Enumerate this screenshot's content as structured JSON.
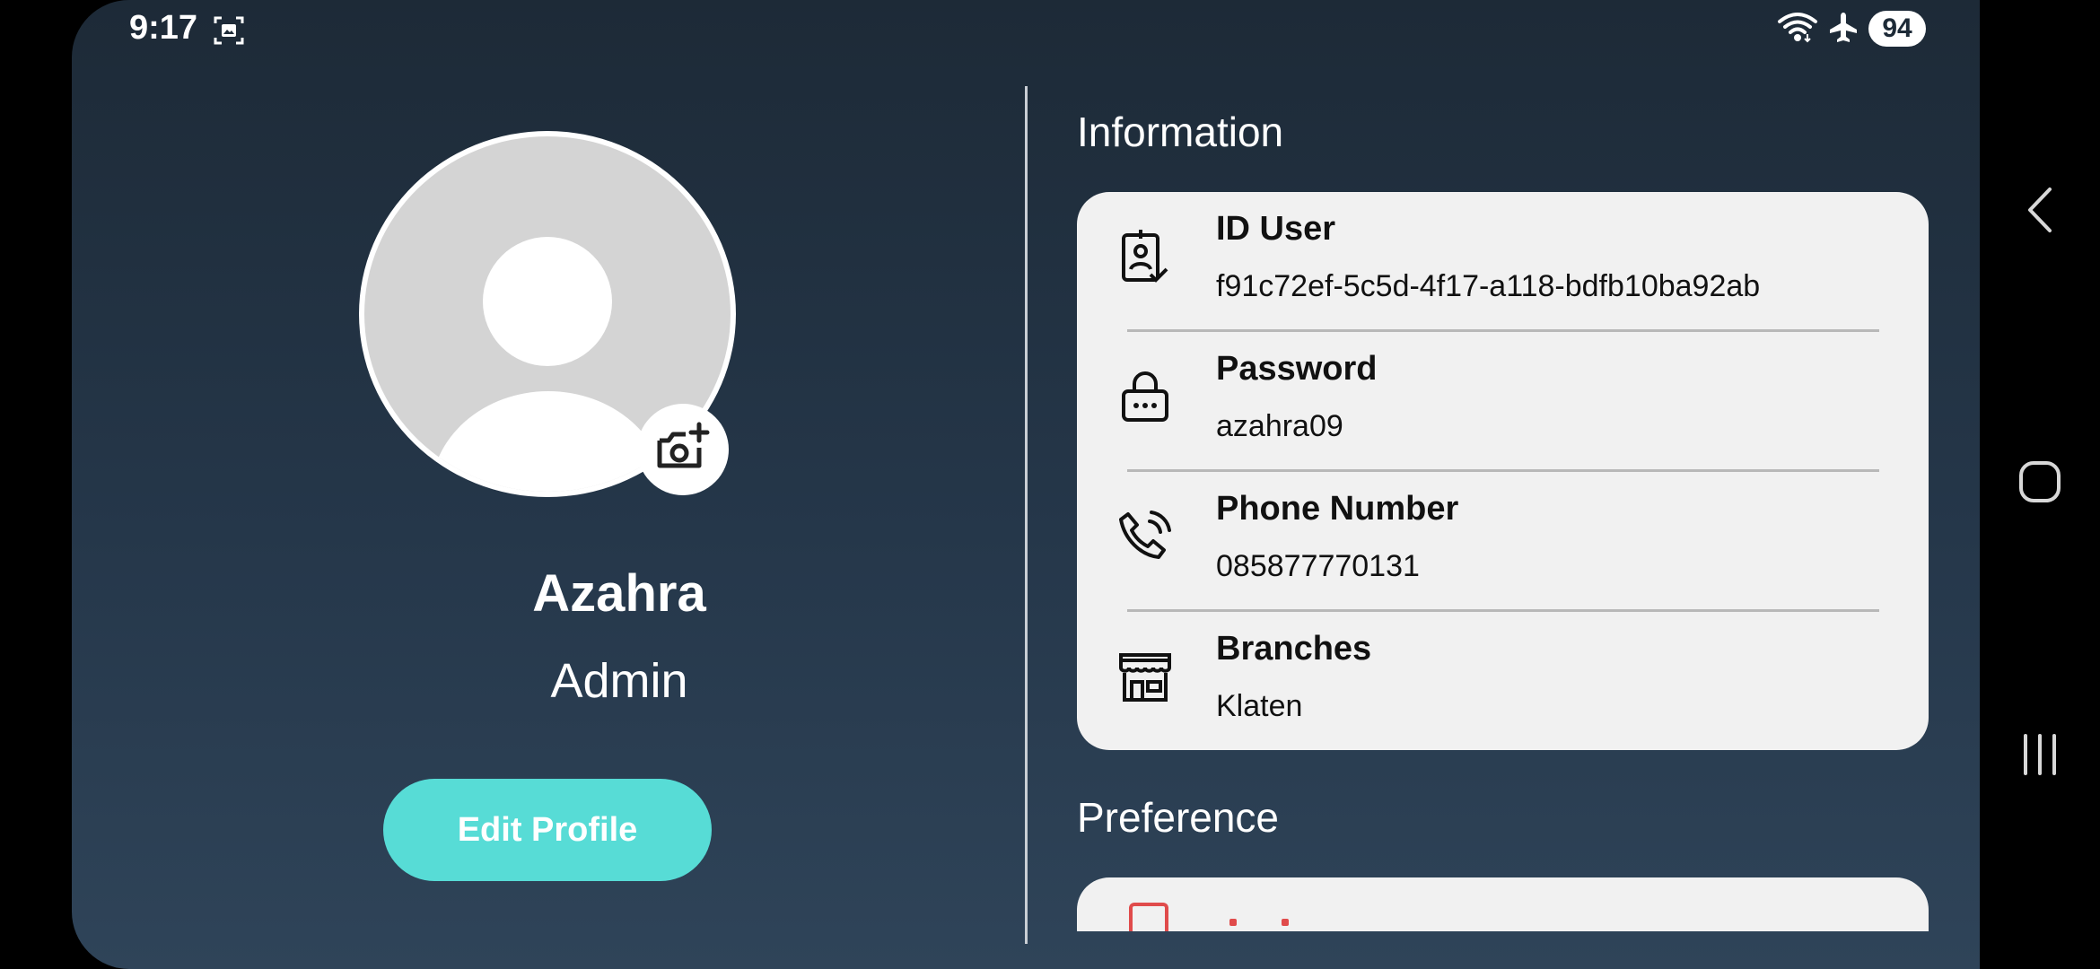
{
  "status_bar": {
    "time": "9:17",
    "battery": "94",
    "icons": [
      "screenshot-icon",
      "wifi-icon",
      "airplane-icon"
    ]
  },
  "profile": {
    "name": "Azahra",
    "role": "Admin",
    "edit_button": "Edit Profile"
  },
  "information": {
    "title": "Information",
    "rows": [
      {
        "icon": "id-badge-icon",
        "label": "ID User",
        "value": "f91c72ef-5c5d-4f17-a118-bdfb10ba92ab"
      },
      {
        "icon": "lock-icon",
        "label": "Password",
        "value": "azahra09"
      },
      {
        "icon": "phone-call-icon",
        "label": "Phone Number",
        "value": "085877770131"
      },
      {
        "icon": "store-icon",
        "label": "Branches",
        "value": "Klaten"
      }
    ]
  },
  "preference": {
    "title": "Preference"
  },
  "colors": {
    "accent": "#57dcd6",
    "card_bg": "#f1f1f1",
    "background_top": "#1d2a37",
    "background_bottom": "#2f4459"
  }
}
